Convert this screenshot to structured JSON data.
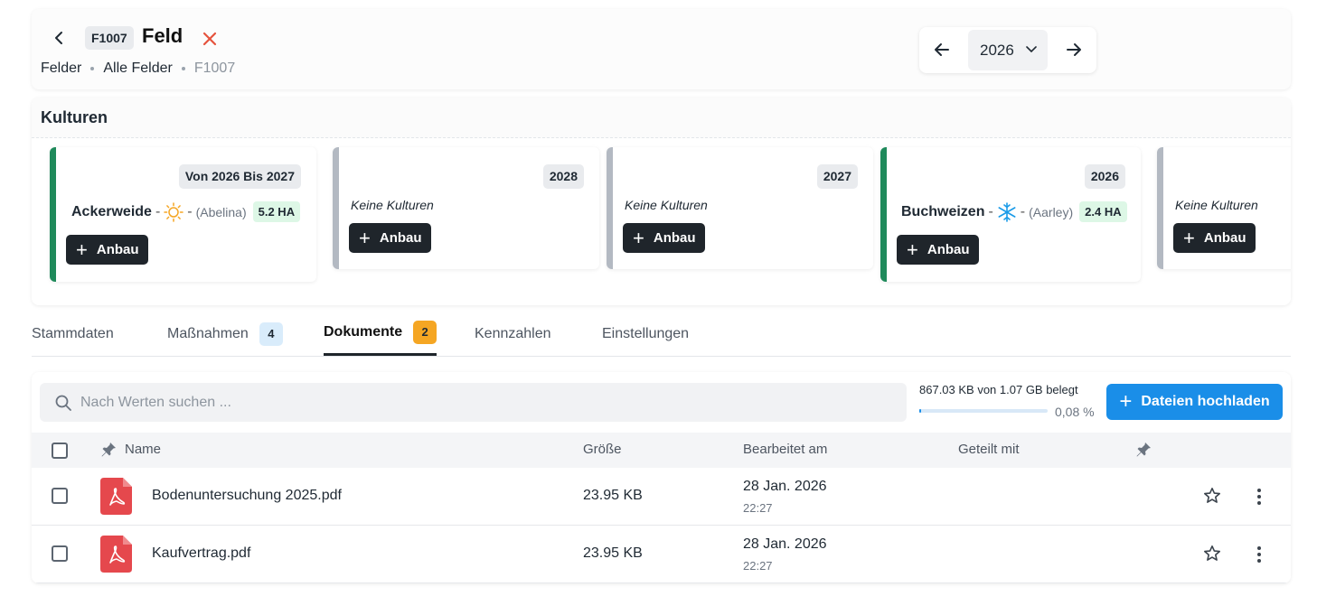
{
  "header": {
    "code": "F1007",
    "title": "Feld",
    "breadcrumb": [
      "Felder",
      "Alle Felder",
      "F1007"
    ],
    "year": "2026"
  },
  "kulturen": {
    "title": "Kulturen",
    "cards": [
      {
        "badge": "Von 2026 Bis 2027",
        "accent": "#1f8a5b",
        "crop": "Ackerweide",
        "icon": "sun-icon",
        "variety": "(Abelina)",
        "area": "5.2 HA",
        "empty": "",
        "button": "Anbau"
      },
      {
        "badge": "2028",
        "accent": "#b3b9c2",
        "crop": "",
        "variety": "",
        "area": "",
        "empty": "Keine Kulturen",
        "button": "Anbau"
      },
      {
        "badge": "2027",
        "accent": "#b3b9c2",
        "crop": "",
        "variety": "",
        "area": "",
        "empty": "Keine Kulturen",
        "button": "Anbau"
      },
      {
        "badge": "2026",
        "accent": "#1f8a5b",
        "crop": "Buchweizen",
        "icon": "snowflake-icon",
        "variety": "(Aarley)",
        "area": "2.4 HA",
        "empty": "",
        "button": "Anbau"
      },
      {
        "badge": "",
        "accent": "#b3b9c2",
        "crop": "",
        "variety": "",
        "area": "",
        "empty": "Keine Kulturen",
        "button": "Anbau"
      }
    ]
  },
  "tabs": [
    {
      "label": "Stammdaten",
      "count": ""
    },
    {
      "label": "Maßnahmen",
      "count": "4",
      "count_bg": "#d9ecfb"
    },
    {
      "label": "Dokumente",
      "count": "2",
      "count_bg": "#f5a623"
    },
    {
      "label": "Kennzahlen",
      "count": ""
    },
    {
      "label": "Einstellungen",
      "count": ""
    }
  ],
  "documents": {
    "search_placeholder": "Nach Werten suchen ...",
    "storage_used": "867.03 KB von 1.07 GB belegt",
    "storage_fraction": 0.0008,
    "storage_percent": "0,08 %",
    "upload_label": "Dateien hochladen",
    "columns": {
      "name": "Name",
      "size": "Größe",
      "edited": "Bearbeitet am",
      "shared": "Geteilt mit"
    },
    "rows": [
      {
        "name": "Bodenuntersuchung 2025.pdf",
        "size": "23.95 KB",
        "date": "28 Jan. 2026",
        "time": "22:27"
      },
      {
        "name": "Kaufvertrag.pdf",
        "size": "23.95 KB",
        "date": "28 Jan. 2026",
        "time": "22:27"
      }
    ]
  },
  "colors": {
    "accent_blue": "#1a8ee8",
    "accent_green": "#1f8a5b",
    "danger": "#e5533d",
    "dark_button": "#1f252b",
    "pdf_red": "#e5484d"
  }
}
